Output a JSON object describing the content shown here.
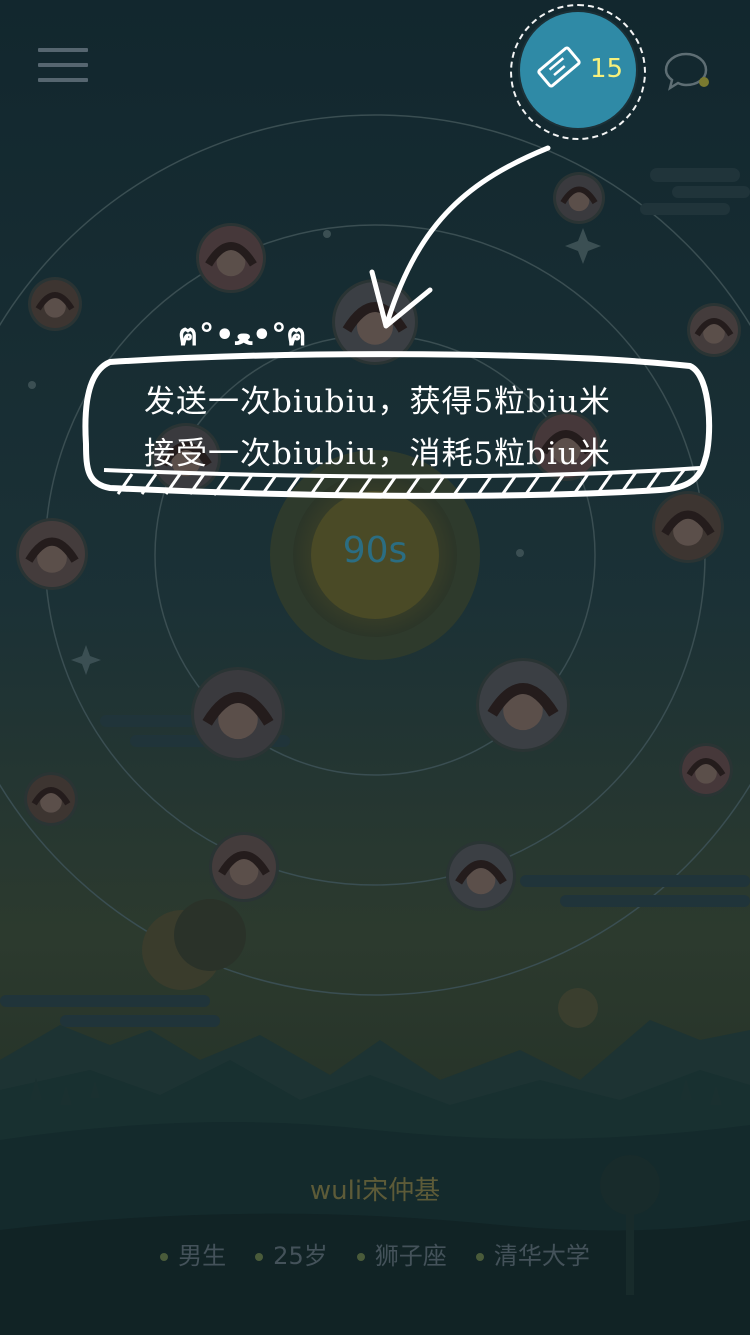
{
  "header": {
    "menu_icon": "hamburger-menu-icon",
    "ticket_icon": "ticket-icon",
    "ticket_count": "15",
    "chat_icon": "chat-bubble-icon"
  },
  "radar": {
    "timer": "90s"
  },
  "tip": {
    "face": "ฅ°•ﻌ•°ฅ",
    "line1": "发送一次biubiu，获得5粒biu米",
    "line2": "接受一次biubiu，消耗5粒biu米"
  },
  "profile": {
    "name": "wuli宋仲基",
    "tags": [
      "男生",
      "25岁",
      "狮子座",
      "清华大学"
    ]
  },
  "colors": {
    "overlay": "#0b1a20",
    "ticket": "#2f8aa6",
    "ticket_count": "#f6f07c",
    "tip_text": "#ffffff"
  }
}
